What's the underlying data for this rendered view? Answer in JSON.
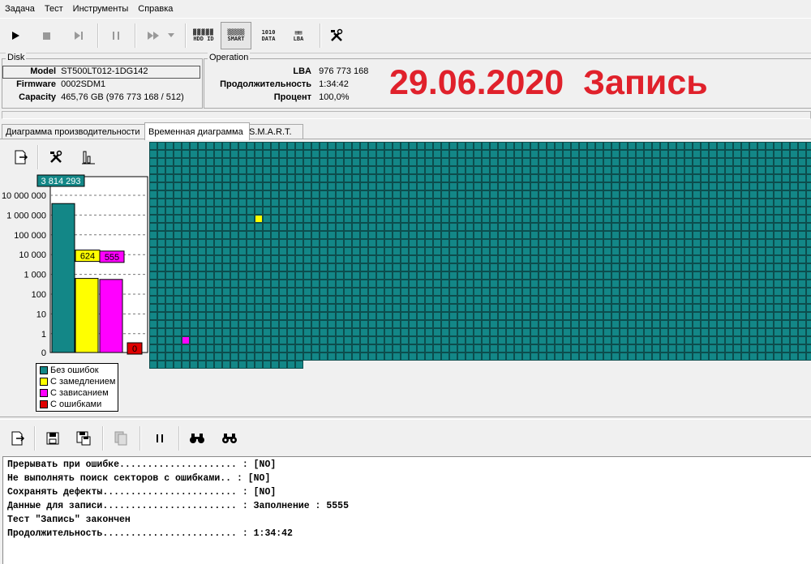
{
  "menu": [
    "Задача",
    "Тест",
    "Инструменты",
    "Справка"
  ],
  "toolbar": {
    "hdd_id": "HDD ID",
    "smart": "SMART",
    "data": "DATA",
    "lba": "LBA"
  },
  "disk": {
    "title": "Disk",
    "model_label": "Model",
    "model": "ST500LT012-1DG142",
    "firmware_label": "Firmware",
    "firmware": "0002SDM1",
    "capacity_label": "Capacity",
    "capacity": "465,76 GB (976 773 168 / 512)"
  },
  "operation": {
    "title": "Operation",
    "lba_label": "LBA",
    "lba": "976 773 168",
    "duration_label": "Продолжительность",
    "duration": "1:34:42",
    "percent_label": "Процент",
    "percent": "100,0%"
  },
  "overlay": "29.06.2020  Запись",
  "tabs": [
    "Диаграмма производительности",
    "Временная диаграмма",
    "S.M.A.R.T."
  ],
  "active_tab": 1,
  "chart_data": {
    "type": "bar",
    "scale": "log",
    "categories": [
      "Без ошибок",
      "С замедлением",
      "С зависанием",
      "С ошибками"
    ],
    "values": [
      3814293,
      624,
      555,
      0
    ],
    "value_labels": [
      "3 814 293",
      "624",
      "555",
      "0"
    ],
    "colors": [
      "#138787",
      "#ffff00",
      "#ff00ff",
      "#e00000"
    ],
    "y_ticks": [
      "10 000 000",
      "1 000 000",
      "100 000",
      "10 000",
      "1 000",
      "100",
      "10",
      "1",
      "0"
    ],
    "legend": [
      "Без ошибок",
      "С замедлением",
      "С зависанием",
      "С ошибками"
    ]
  },
  "block_map": {
    "normal_color": "#138787",
    "slow_color": "#ffff00",
    "hang_color": "#ff00ff",
    "slow_cell": [
      13,
      9
    ],
    "hang_cell": [
      4,
      24
    ]
  },
  "log": [
    "Прерывать при ошибке..................... : [NO]",
    "Не выполнять поиск секторов с ошибками.. : [NO]",
    "Сохранять дефекты........................ : [NO]",
    "Данные для записи........................ : Заполнение : 5555",
    "Тест \"Запись\" закончен",
    "Продолжительность........................ : 1:34:42"
  ]
}
